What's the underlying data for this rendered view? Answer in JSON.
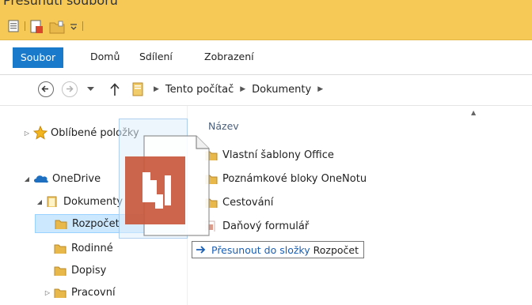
{
  "window": {
    "title": "Přesunutí souboru"
  },
  "quick_access": {
    "icons": [
      "properties-icon",
      "new-document-icon",
      "new-folder-icon",
      "dropdown-icon"
    ]
  },
  "ribbon": {
    "tabs": [
      {
        "label": "Soubor",
        "active": true
      },
      {
        "label": "Domů"
      },
      {
        "label": "Sdílení"
      },
      {
        "label": "Zobrazení"
      }
    ]
  },
  "address": {
    "crumbs": [
      "Tento počítač",
      "Dokumenty"
    ]
  },
  "navigation": {
    "items": [
      {
        "label": "Oblíbené položky",
        "icon": "star-icon"
      },
      {
        "label": "OneDrive",
        "icon": "cloud-icon"
      },
      {
        "label": "Dokumenty",
        "icon": "folder-icon"
      },
      {
        "label": "Rozpočet",
        "icon": "folder-icon",
        "selected": true
      },
      {
        "label": "Rodinné",
        "icon": "folder-icon"
      },
      {
        "label": "Dopisy",
        "icon": "folder-icon"
      },
      {
        "label": "Pracovní",
        "icon": "folder-icon"
      }
    ]
  },
  "files": {
    "column_header": "Název",
    "items": [
      {
        "name": "Vlastní šablony Office",
        "type": "folder"
      },
      {
        "name": "Poznámkové bloky OneNotu",
        "type": "folder"
      },
      {
        "name": "Cestování",
        "type": "folder"
      },
      {
        "name": "Daňový formulář",
        "type": "document"
      }
    ]
  },
  "drag_tooltip": {
    "action": "Přesunout do složky",
    "target": "Rozpočet"
  },
  "colors": {
    "title_bar": "#f6c956",
    "file_tab": "#1979ca",
    "selection": "#cce8ff",
    "doc_icon": "#c8583c",
    "folder": "#e8b84a",
    "link": "#1a5fb4"
  }
}
